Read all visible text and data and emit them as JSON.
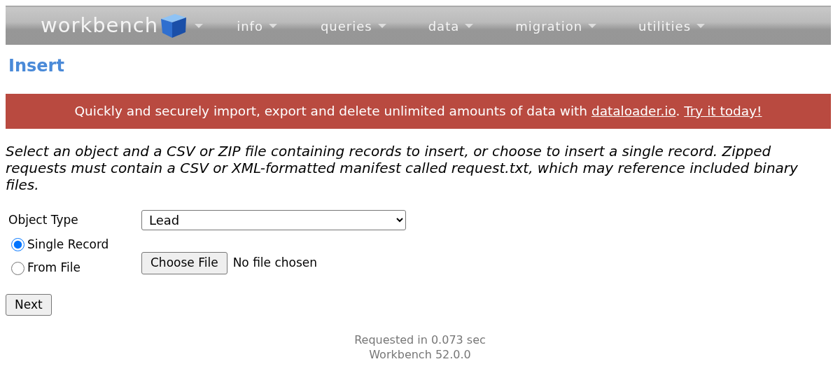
{
  "nav": {
    "brand": "workbench",
    "menus": [
      {
        "label": "info"
      },
      {
        "label": "queries"
      },
      {
        "label": "data"
      },
      {
        "label": "migration"
      },
      {
        "label": "utilities"
      }
    ]
  },
  "title": "Insert",
  "banner": {
    "parts": [
      {
        "kind": "text",
        "text": "Quickly and securely import, export and delete unlimited amounts of data with "
      },
      {
        "kind": "link",
        "text": "dataloader.io"
      },
      {
        "kind": "text",
        "text": ". "
      },
      {
        "kind": "link",
        "text": "Try it today!"
      }
    ]
  },
  "description": "Select an object and a CSV or ZIP file containing records to insert, or choose to insert a single record. Zipped requests must contain a CSV or XML-formatted manifest called request.txt, which may reference included binary files.",
  "object_type": {
    "label": "Object Type",
    "value": "Lead"
  },
  "modes": [
    {
      "label": "Single Record",
      "selected": true
    },
    {
      "label": "From File",
      "selected": false
    }
  ],
  "file": {
    "button": "Choose File",
    "status": "No file chosen"
  },
  "next_button": "Next",
  "footer": [
    "Requested in 0.073 sec",
    "Workbench 52.0.0"
  ]
}
